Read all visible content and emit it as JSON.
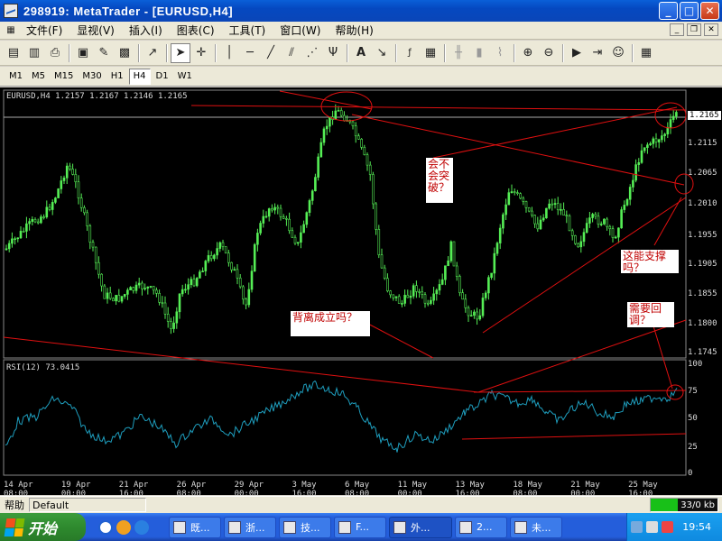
{
  "window": {
    "title": "298919: MetaTrader - [EURUSD,H4]",
    "buttons": [
      "_",
      "□",
      "✕"
    ]
  },
  "menu": {
    "items": [
      "文件(F)",
      "显视(V)",
      "插入(I)",
      "图表(C)",
      "工具(T)",
      "窗口(W)",
      "帮助(H)"
    ]
  },
  "timeframes": {
    "items": [
      "M1",
      "M5",
      "M15",
      "M30",
      "H1",
      "H4",
      "D1",
      "W1"
    ],
    "active": "H4"
  },
  "chart": {
    "header": "EURUSD,H4  1.2157 1.2167 1.2146 1.2165",
    "price_scale": [
      "1.2115",
      "1.2065",
      "1.2010",
      "1.1955",
      "1.1905",
      "1.1855",
      "1.1800",
      "1.1745"
    ],
    "current_price": "1.2165",
    "rsi_header": "RSI(12)  73.0415",
    "rsi_scale": [
      "100",
      "75",
      "50",
      "25",
      "0"
    ],
    "time_axis": [
      "14 Apr 08:00",
      "19 Apr 00:00",
      "21 Apr 16:00",
      "26 Apr 08:00",
      "29 Apr 00:00",
      "3 May 16:00",
      "6 May 08:00",
      "11 May 00:00",
      "13 May 16:00",
      "18 May 08:00",
      "21 May 00:00",
      "25 May 16:00"
    ],
    "annotations": {
      "top": "会不会突破？",
      "support": "这能支撑吗？",
      "divergence": "背离成立吗？",
      "pullback": "需要回调？"
    },
    "colors": {
      "candles": "#55ee55",
      "rsi": "#1e9ebe",
      "lines": "#e01010",
      "background": "#000000"
    }
  },
  "status": {
    "profile": "Default",
    "traffic": "33/0 kb",
    "left_label": "帮助"
  },
  "taskbar": {
    "start": "开始",
    "tasks": [
      "既...",
      "浙...",
      "技...",
      "F...",
      "外...",
      "2...",
      "未..."
    ],
    "clock": "19:54"
  }
}
